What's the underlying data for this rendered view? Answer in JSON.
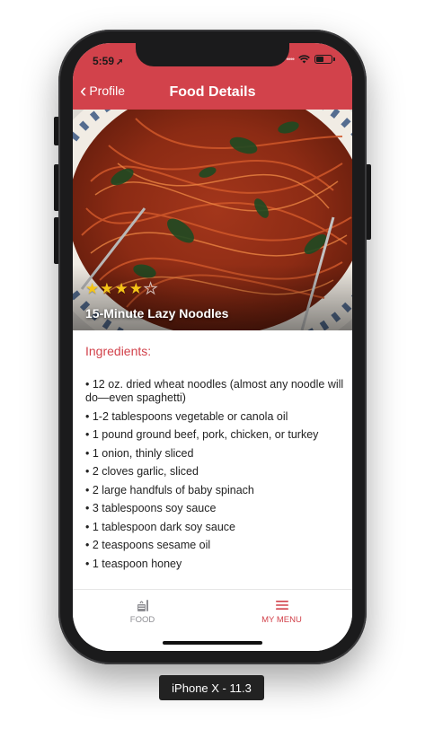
{
  "status_bar": {
    "time": "5:59",
    "arrow": "➚"
  },
  "nav": {
    "back_label": "Profile",
    "title": "Food Details"
  },
  "hero": {
    "dish_name": "15-Minute Lazy Noodles",
    "rating": 4,
    "rating_max": 5
  },
  "ingredients": {
    "title": "Ingredients:",
    "items": [
      "12 oz. dried wheat noodles (almost any noodle will do—even spaghetti)",
      "1-2 tablespoons vegetable or canola oil",
      "1 pound ground beef, pork, chicken, or turkey",
      "1 onion, thinly sliced",
      "2 cloves garlic, sliced",
      "2 large handfuls of baby spinach",
      "3 tablespoons soy sauce",
      "1 tablespoon dark soy sauce",
      "2 teaspoons sesame oil",
      "1 teaspoon honey"
    ]
  },
  "tabbar": {
    "food_label": "FOOD",
    "menu_label": "MY MENU",
    "food_icon": "food-icon",
    "menu_icon": "menu-icon",
    "active": "menu"
  },
  "device_label": "iPhone X - 11.3",
  "colors": {
    "accent": "#d2424b",
    "inactive": "#8e8e93",
    "star": "#f5c518"
  }
}
